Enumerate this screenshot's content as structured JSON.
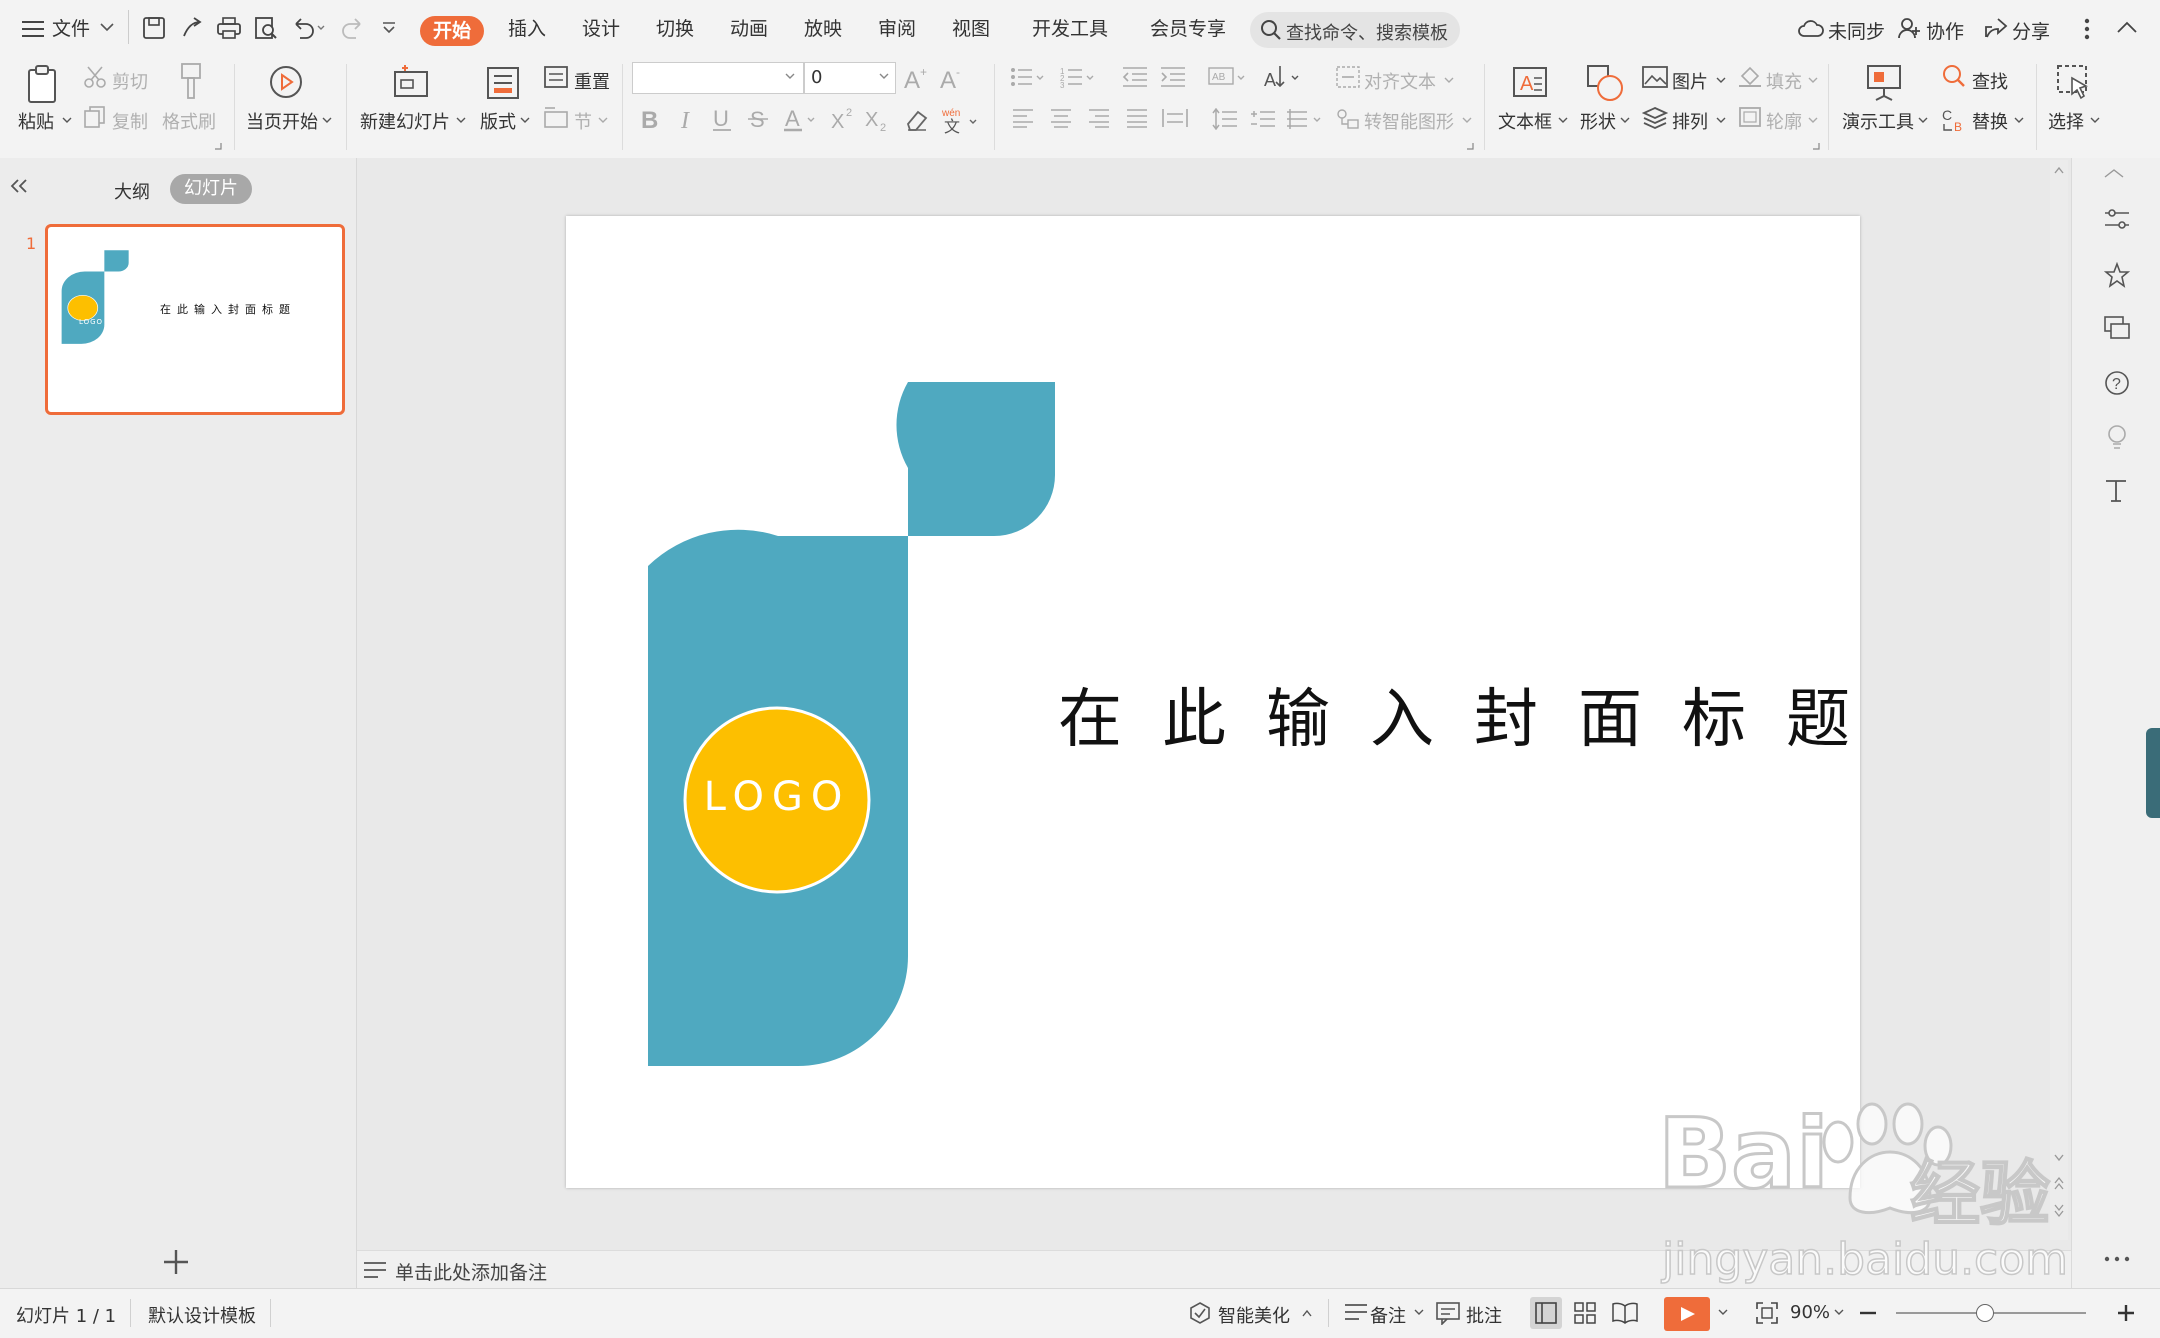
{
  "menu": {
    "file": "文件",
    "tabs": [
      "开始",
      "插入",
      "设计",
      "切换",
      "动画",
      "放映",
      "审阅",
      "视图",
      "开发工具",
      "会员专享"
    ],
    "active_tab": "开始",
    "search_placeholder": "查找命令、搜索模板",
    "sync": "未同步",
    "collab": "协作",
    "share": "分享"
  },
  "ribbon": {
    "paste": "粘贴",
    "cut": "剪切",
    "copy": "复制",
    "format_painter": "格式刷",
    "from_current": "当页开始",
    "new_slide": "新建幻灯片",
    "layout": "版式",
    "reset": "重置",
    "section": "节",
    "font_size": "0",
    "align_text": "对齐文本",
    "smartart": "转智能图形",
    "textbox": "文本框",
    "shape": "形状",
    "picture": "图片",
    "arrange": "排列",
    "fill": "填充",
    "outline": "轮廓",
    "presenter_tools": "演示工具",
    "find": "查找",
    "replace": "替换",
    "select": "选择"
  },
  "leftpanel": {
    "outline_tab": "大纲",
    "slides_tab": "幻灯片",
    "slide_number": "1",
    "thumb_title": "在此输入封面标题",
    "thumb_logo": "LOGO"
  },
  "slide": {
    "title": "在此输入封面标题",
    "logo": "LOGO"
  },
  "notes": {
    "placeholder": "单击此处添加备注"
  },
  "status": {
    "slide_counter": "幻灯片 1 / 1",
    "template": "默认设计模板",
    "beautify": "智能美化",
    "notes": "备注",
    "comments": "批注",
    "zoom": "90%"
  },
  "watermark": {
    "brand": "Bai",
    "brand2": "经验",
    "url": "jingyan.baidu.com"
  },
  "colors": {
    "accent": "#ef6c3a",
    "teal": "#4fa9c0",
    "logo": "#fdbf00"
  }
}
